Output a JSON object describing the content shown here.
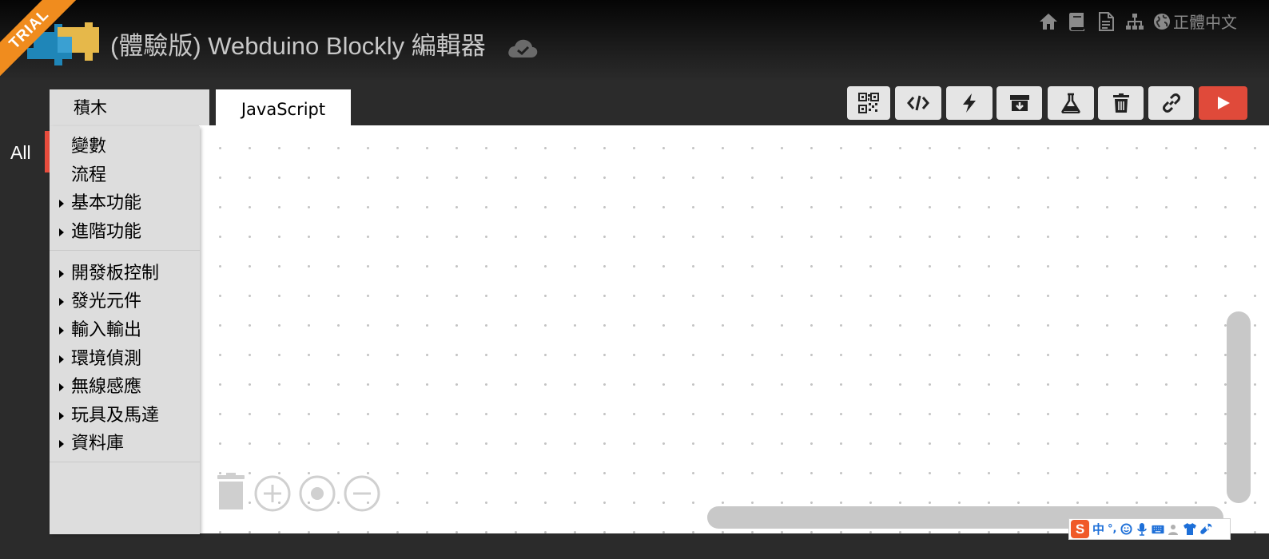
{
  "header": {
    "ribbon": "TRIAL",
    "title": "(體驗版) Webduino Blockly 編輯器",
    "language": "正體中文",
    "nav_icons": [
      "home-icon",
      "book-icon",
      "document-icon",
      "sitemap-icon",
      "globe-icon"
    ]
  },
  "tabs": {
    "blocks": "積木",
    "javascript": "JavaScript"
  },
  "toolbar": {
    "buttons": [
      "qr-code-icon",
      "code-icon",
      "lightning-icon",
      "archive-download-icon",
      "flask-icon",
      "trash-icon",
      "link-icon",
      "play-icon"
    ]
  },
  "toolbox": {
    "all_label": "All",
    "categories": [
      {
        "label": "變數",
        "expandable": false
      },
      {
        "label": "流程",
        "expandable": false
      },
      {
        "label": "基本功能",
        "expandable": true
      },
      {
        "label": "進階功能",
        "expandable": true
      },
      {
        "label": "開發板控制",
        "expandable": true
      },
      {
        "label": "發光元件",
        "expandable": true
      },
      {
        "label": "輸入輸出",
        "expandable": true
      },
      {
        "label": "環境偵測",
        "expandable": true
      },
      {
        "label": "無線感應",
        "expandable": true
      },
      {
        "label": "玩具及馬達",
        "expandable": true
      },
      {
        "label": "資料庫",
        "expandable": true
      }
    ]
  },
  "ime": {
    "logo": "S",
    "mode": "中",
    "punct": "°,"
  },
  "colors": {
    "accent_red": "#e84c3d",
    "run_button": "#e04a3a",
    "trial_orange": "#f08c1e"
  }
}
